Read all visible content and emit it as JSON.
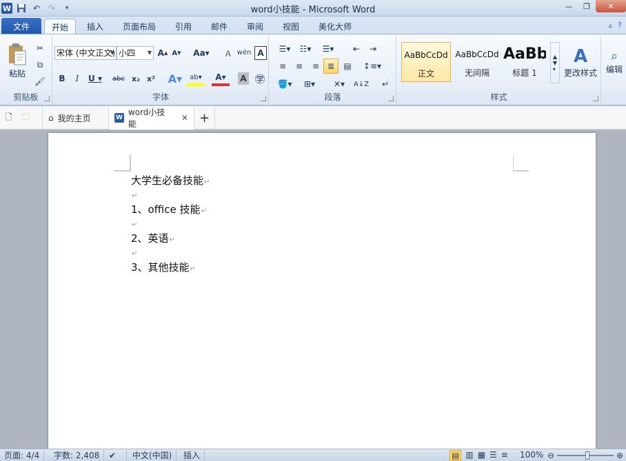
{
  "window": {
    "title": "word小技能 - Microsoft Word",
    "app_icon": "W"
  },
  "quick_access": {
    "icons": [
      "word-app-icon",
      "save-icon",
      "undo-icon",
      "redo-icon",
      "customize-icon"
    ]
  },
  "tabs": {
    "file": "文件",
    "items": [
      "开始",
      "插入",
      "页面布局",
      "引用",
      "邮件",
      "审阅",
      "视图",
      "美化大师"
    ],
    "active": "开始"
  },
  "ribbon": {
    "clipboard": {
      "label": "剪贴板",
      "paste": "粘贴"
    },
    "font": {
      "label": "字体",
      "font_name": "宋体 (中文正文)",
      "font_size": "小四"
    },
    "paragraph": {
      "label": "段落"
    },
    "styles": {
      "label": "样式",
      "items": [
        {
          "preview": "AaBbCcDd",
          "name": "正文"
        },
        {
          "preview": "AaBbCcDd",
          "name": "无间隔"
        },
        {
          "preview": "AaBb",
          "name": "标题 1"
        }
      ],
      "change_styles": "更改样式"
    },
    "editing": {
      "label": "编辑"
    }
  },
  "doc_tabs": {
    "home": "我的主页",
    "document": "word小技能"
  },
  "document": {
    "lines": [
      "大学生必备技能",
      "",
      "1、office 技能",
      "",
      "2、英语",
      "",
      "3、其他技能"
    ]
  },
  "status": {
    "page": "页面: 4/4",
    "words": "字数: 2,408",
    "language": "中文(中国)",
    "mode": "插入",
    "zoom": "100%"
  },
  "colors": {
    "file_tab": "#2a5fb4",
    "ribbon_bg": "#e6eef8",
    "selected_style": "#ffe8a6"
  }
}
